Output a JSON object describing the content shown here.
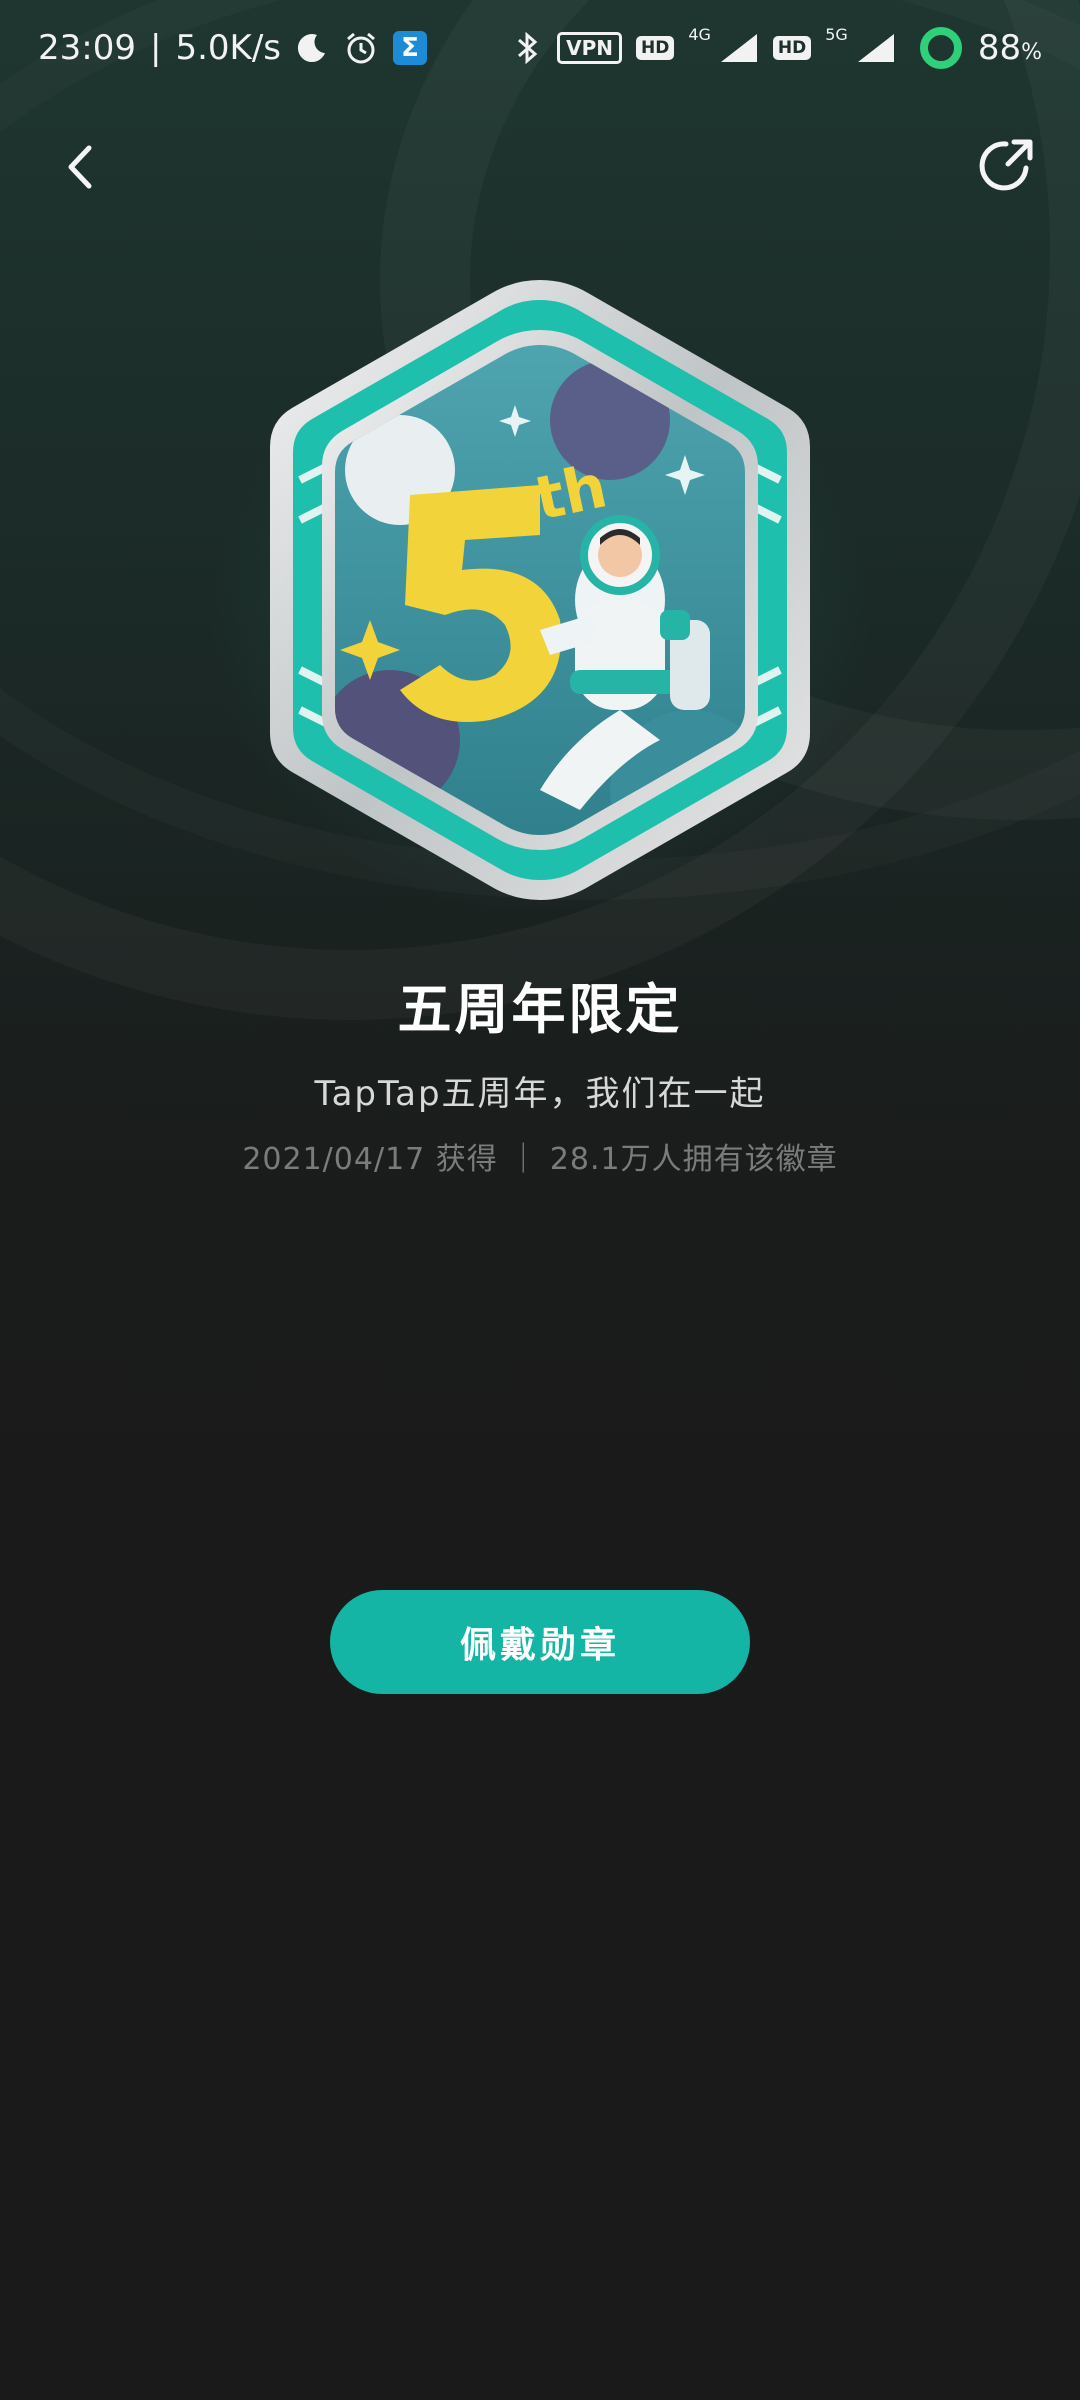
{
  "status_bar": {
    "time": "23:09",
    "separator": "|",
    "net_speed": "5.0K/s",
    "vpn": "VPN",
    "hd1": "HD",
    "net1": "4G",
    "hd2": "HD",
    "net2": "5G",
    "battery": "88",
    "battery_unit": "%",
    "sigma": "Σ"
  },
  "nav": {
    "back_icon": "chevron-left-icon",
    "share_icon": "share-arrow-icon"
  },
  "badge": {
    "art_text": "5th",
    "title": "五周年限定",
    "description": "TapTap五周年，我们在一起",
    "meta": "2021/04/17 获得 ｜ 28.1万人拥有该徽章"
  },
  "actions": {
    "wear_label": "佩戴勋章"
  },
  "colors": {
    "accent": "#14b5a4",
    "background": "#1a1a1a",
    "badge_teal": "#1fbfae",
    "badge_yellow": "#f2d33a"
  }
}
